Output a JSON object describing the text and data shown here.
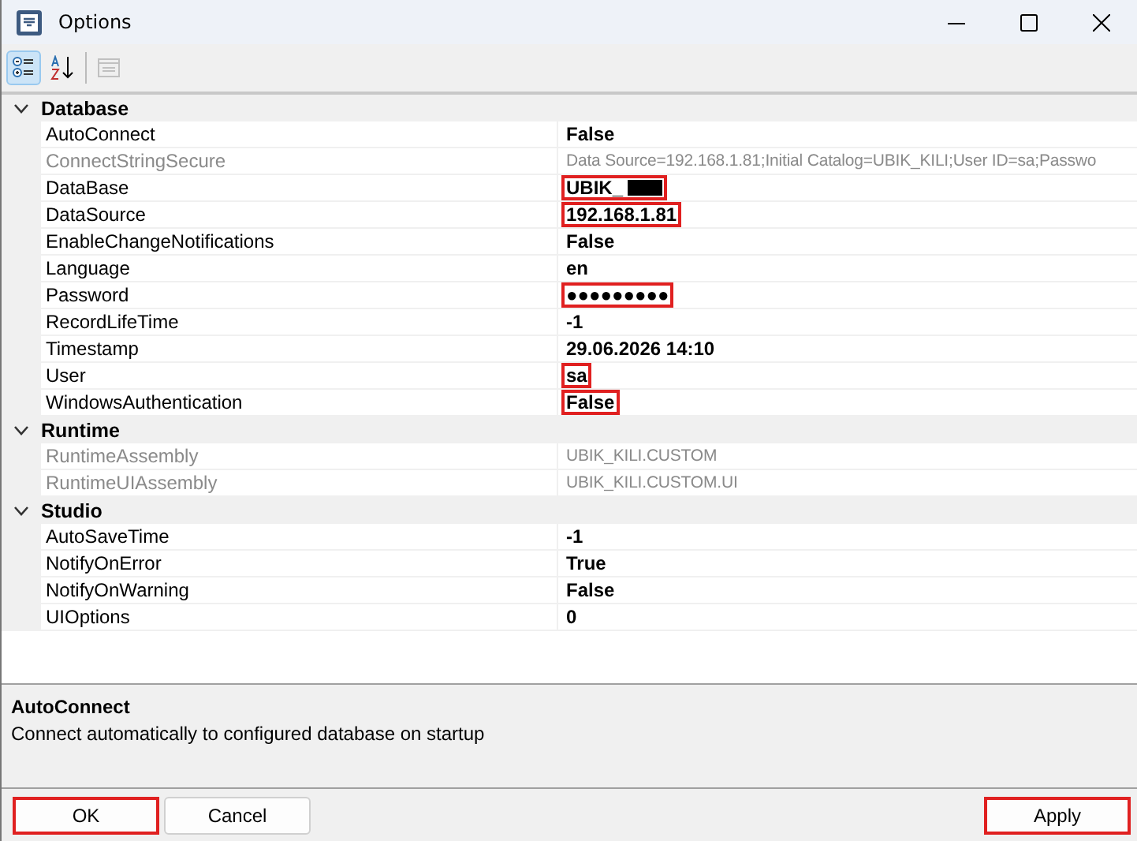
{
  "window": {
    "title": "Options"
  },
  "toolbar": [
    {
      "kind": "categorized",
      "selected": true,
      "disabled": false
    },
    {
      "kind": "alphabetical",
      "selected": false,
      "disabled": false
    },
    {
      "kind": "pages",
      "selected": false,
      "disabled": true
    }
  ],
  "categories": [
    {
      "name": "Database",
      "expanded": true,
      "properties": [
        {
          "name": "AutoConnect",
          "value": "False",
          "readonly": false,
          "highlighted": false,
          "redacted": false
        },
        {
          "name": "ConnectStringSecure",
          "value": "Data Source=192.168.1.81;Initial Catalog=UBIK_KILI;User ID=sa;Passwo",
          "readonly": true,
          "highlighted": false,
          "redacted": false
        },
        {
          "name": "DataBase",
          "value": "UBIK_",
          "readonly": false,
          "highlighted": true,
          "redacted": true
        },
        {
          "name": "DataSource",
          "value": "192.168.1.81",
          "readonly": false,
          "highlighted": true,
          "redacted": false
        },
        {
          "name": "EnableChangeNotifications",
          "value": "False",
          "readonly": false,
          "highlighted": false,
          "redacted": false
        },
        {
          "name": "Language",
          "value": "en",
          "readonly": false,
          "highlighted": false,
          "redacted": false
        },
        {
          "name": "Password",
          "value": "●●●●●●●●●",
          "readonly": false,
          "highlighted": true,
          "redacted": false
        },
        {
          "name": "RecordLifeTime",
          "value": "-1",
          "readonly": false,
          "highlighted": false,
          "redacted": false
        },
        {
          "name": "Timestamp",
          "value": "29.06.2026 14:10",
          "readonly": false,
          "highlighted": false,
          "redacted": false
        },
        {
          "name": "User",
          "value": "sa",
          "readonly": false,
          "highlighted": true,
          "redacted": false
        },
        {
          "name": "WindowsAuthentication",
          "value": "False",
          "readonly": false,
          "highlighted": true,
          "redacted": false
        }
      ]
    },
    {
      "name": "Runtime",
      "expanded": true,
      "properties": [
        {
          "name": "RuntimeAssembly",
          "value": "UBIK_KILI.CUSTOM",
          "readonly": true,
          "highlighted": false,
          "redacted": false
        },
        {
          "name": "RuntimeUIAssembly",
          "value": "UBIK_KILI.CUSTOM.UI",
          "readonly": true,
          "highlighted": false,
          "redacted": false
        }
      ]
    },
    {
      "name": "Studio",
      "expanded": true,
      "properties": [
        {
          "name": "AutoSaveTime",
          "value": "-1",
          "readonly": false,
          "highlighted": false,
          "redacted": false
        },
        {
          "name": "NotifyOnError",
          "value": "True",
          "readonly": false,
          "highlighted": false,
          "redacted": false
        },
        {
          "name": "NotifyOnWarning",
          "value": "False",
          "readonly": false,
          "highlighted": false,
          "redacted": false
        },
        {
          "name": "UIOptions",
          "value": "0",
          "readonly": false,
          "highlighted": false,
          "redacted": false
        }
      ]
    }
  ],
  "description": {
    "title": "AutoConnect",
    "text": "Connect automatically to configured database on startup"
  },
  "buttons": [
    {
      "label": "OK",
      "highlighted": true
    },
    {
      "label": "Cancel",
      "highlighted": false
    },
    {
      "label": "Apply",
      "highlighted": true
    }
  ]
}
